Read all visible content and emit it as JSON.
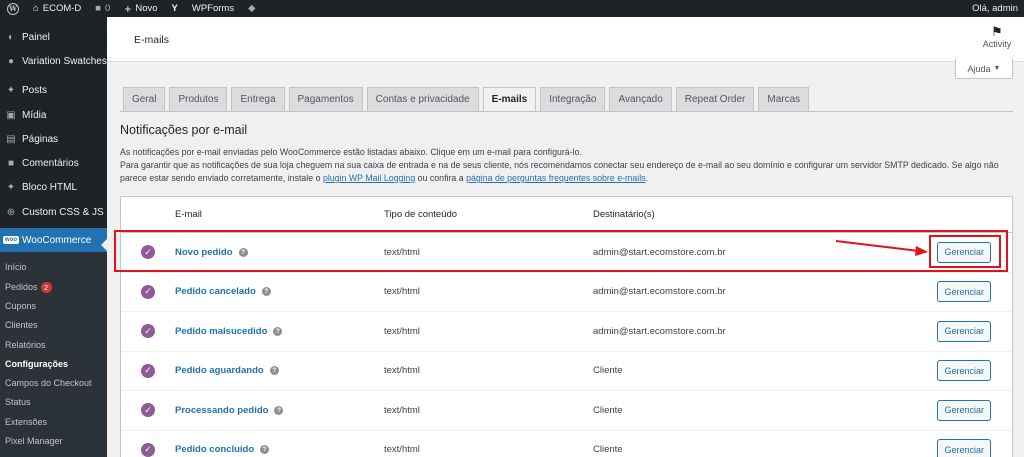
{
  "adminbar": {
    "site_name": "ECOM-D",
    "comments_count": "0",
    "new_label": "Novo",
    "wpforms_label": "WPForms",
    "greeting": "Olá, admin"
  },
  "sidebar": {
    "items": [
      {
        "label": "Painel",
        "icon": "dashboard-icon"
      },
      {
        "label": "Variation Swatches",
        "icon": "swatches-icon"
      },
      {
        "label": "Posts",
        "icon": "pin-icon"
      },
      {
        "label": "Mídia",
        "icon": "media-icon"
      },
      {
        "label": "Páginas",
        "icon": "pages-icon"
      },
      {
        "label": "Comentários",
        "icon": "comments-icon"
      },
      {
        "label": "Bloco HTML",
        "icon": "pin-icon"
      },
      {
        "label": "Custom CSS & JS",
        "icon": "plus-circle-icon"
      }
    ],
    "current": {
      "label": "WooCommerce",
      "badge": "woo"
    },
    "submenu": [
      {
        "label": "Início"
      },
      {
        "label": "Pedidos",
        "count": "2"
      },
      {
        "label": "Cupons"
      },
      {
        "label": "Clientes"
      },
      {
        "label": "Relatórios"
      },
      {
        "label": "Configurações",
        "active": true
      },
      {
        "label": "Campos do Checkout"
      },
      {
        "label": "Status"
      },
      {
        "label": "Extensões"
      },
      {
        "label": "Pixel Manager"
      }
    ]
  },
  "header": {
    "title": "E-mails",
    "activity_label": "Activity",
    "help_label": "Ajuda"
  },
  "tabs": [
    {
      "label": "Geral"
    },
    {
      "label": "Produtos"
    },
    {
      "label": "Entrega"
    },
    {
      "label": "Pagamentos"
    },
    {
      "label": "Contas e privacidade"
    },
    {
      "label": "E-mails",
      "active": true
    },
    {
      "label": "Integração"
    },
    {
      "label": "Avançado"
    },
    {
      "label": "Repeat Order"
    },
    {
      "label": "Marcas"
    }
  ],
  "section": {
    "title": "Notificações por e-mail",
    "desc_line1": "As notificações por e-mail enviadas pelo WooCommerce estão listadas abaixo. Clique em um e-mail para configurá-lo.",
    "desc_line2_a": "Para garantir que as notificações de sua loja cheguem na sua caixa de entrada e na de seus cliente, nós recomendamos conectar seu endereço de e-mail ao seu domínio e configurar um servidor SMTP dedicado. Se algo não parece estar sendo enviado corretamente, instale o ",
    "link1": "plugin WP Mail Logging",
    "desc_line2_b": " ou confira a ",
    "link2": "página de perguntas frequentes sobre e-mails",
    "desc_end": "."
  },
  "table": {
    "headers": {
      "name": "E-mail",
      "type": "Tipo de conteúdo",
      "dest": "Destinatário(s)"
    },
    "rows": [
      {
        "name": "Novo pedido",
        "type": "text/html",
        "dest": "admin@start.ecomstore.com.br",
        "action": "Gerenciar"
      },
      {
        "name": "Pedido cancelado",
        "type": "text/html",
        "dest": "admin@start.ecomstore.com.br",
        "action": "Gerenciar"
      },
      {
        "name": "Pedido malsucedido",
        "type": "text/html",
        "dest": "admin@start.ecomstore.com.br",
        "action": "Gerenciar"
      },
      {
        "name": "Pedido aguardando",
        "type": "text/html",
        "dest": "Cliente",
        "action": "Gerenciar"
      },
      {
        "name": "Processando pedido",
        "type": "text/html",
        "dest": "Cliente",
        "action": "Gerenciar"
      },
      {
        "name": "Pedido concluído",
        "type": "text/html",
        "dest": "Cliente",
        "action": "Gerenciar"
      }
    ]
  },
  "colors": {
    "admin_bg": "#1d2327",
    "accent": "#2271b1",
    "woo_purple": "#8c5c94",
    "highlight_red": "#e0121a"
  }
}
